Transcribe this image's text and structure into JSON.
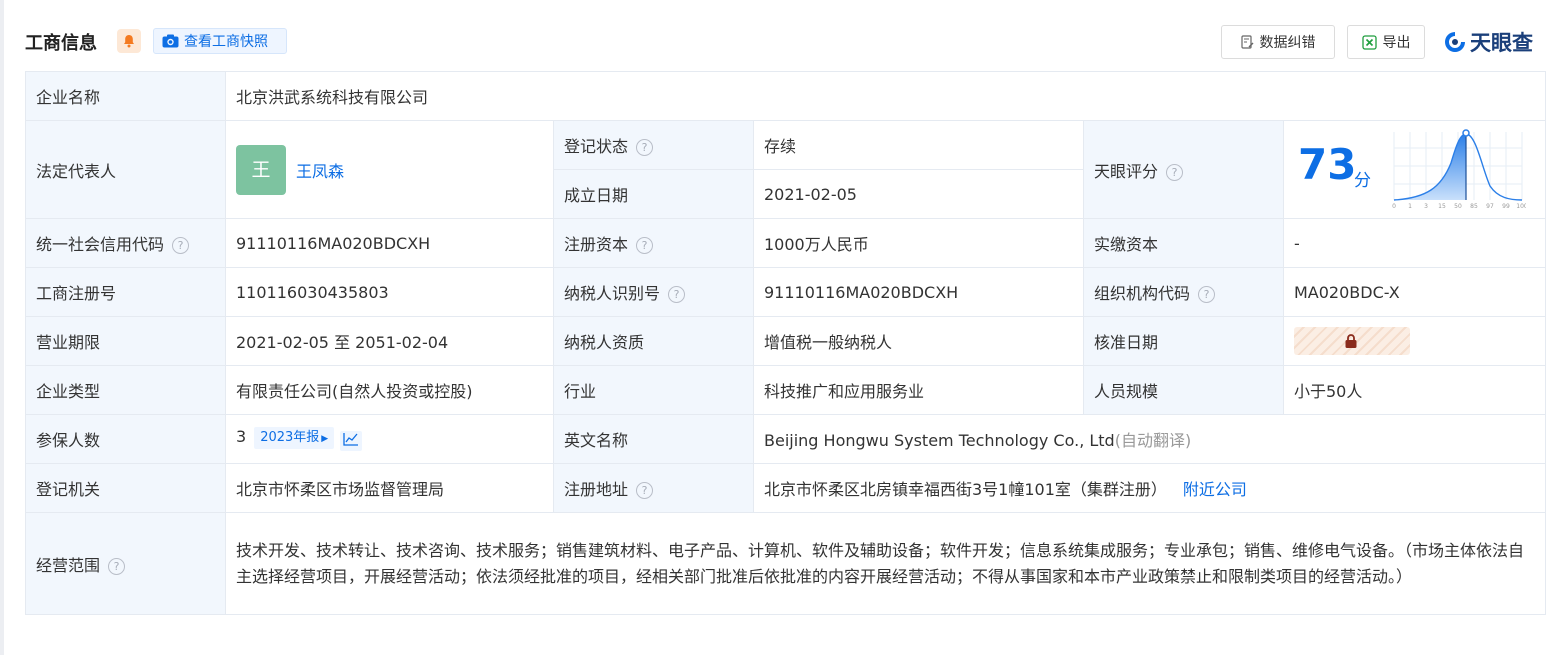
{
  "header": {
    "title": "工商信息",
    "snapshot_label": "查看工商快照",
    "correction_label": "数据纠错",
    "export_label": "导出",
    "logo_text": "天眼查"
  },
  "company": {
    "name_label": "企业名称",
    "name_value": "北京洪武系统科技有限公司",
    "legal_rep_label": "法定代表人",
    "legal_rep_avatar": "王",
    "legal_rep_name": "王凤森",
    "status_label": "登记状态",
    "status_value": "存续",
    "established_label": "成立日期",
    "established_value": "2021-02-05",
    "score_label": "天眼评分",
    "score_value": "73",
    "score_unit": "分",
    "score_axis": [
      "0",
      "1",
      "3",
      "15",
      "50",
      "85",
      "97",
      "99",
      "100"
    ],
    "credit_code_label": "统一社会信用代码",
    "credit_code_value": "91110116MA020BDCXH",
    "reg_capital_label": "注册资本",
    "reg_capital_value": "1000万人民币",
    "paid_capital_label": "实缴资本",
    "paid_capital_value": "-",
    "reg_no_label": "工商注册号",
    "reg_no_value": "110116030435803",
    "taxpayer_id_label": "纳税人识别号",
    "taxpayer_id_value": "91110116MA020BDCXH",
    "org_code_label": "组织机构代码",
    "org_code_value": "MA020BDC-X",
    "term_label": "营业期限",
    "term_value": "2021-02-05 至 2051-02-04",
    "tax_qual_label": "纳税人资质",
    "tax_qual_value": "增值税一般纳税人",
    "approval_label": "核准日期",
    "type_label": "企业类型",
    "type_value": "有限责任公司(自然人投资或控股)",
    "industry_label": "行业",
    "industry_value": "科技推广和应用服务业",
    "staff_label": "人员规模",
    "staff_value": "小于50人",
    "insured_label": "参保人数",
    "insured_value": "3",
    "insured_report": "2023年报",
    "english_label": "英文名称",
    "english_value": "Beijing Hongwu System Technology Co., Ltd",
    "english_note": "(自动翻译)",
    "authority_label": "登记机关",
    "authority_value": "北京市怀柔区市场监督管理局",
    "address_label": "注册地址",
    "address_value": "北京市怀柔区北房镇幸福西街3号1幢101室（集群注册）",
    "nearby_label": "附近公司",
    "scope_label": "经营范围",
    "scope_value": "技术开发、技术转让、技术咨询、技术服务；销售建筑材料、电子产品、计算机、软件及辅助设备；软件开发；信息系统集成服务；专业承包；销售、维修电气设备。（市场主体依法自主选择经营项目，开展经营活动；依法须经批准的项目，经相关部门批准后依批准的内容开展经营活动；不得从事国家和本市产业政策禁止和限制类项目的经营活动。）"
  },
  "colors": {
    "accent": "#0d6ee4",
    "label_bg": "#f2f7fd",
    "status_green": "#1f9e3e",
    "avatar_bg": "#7dc3a0"
  }
}
